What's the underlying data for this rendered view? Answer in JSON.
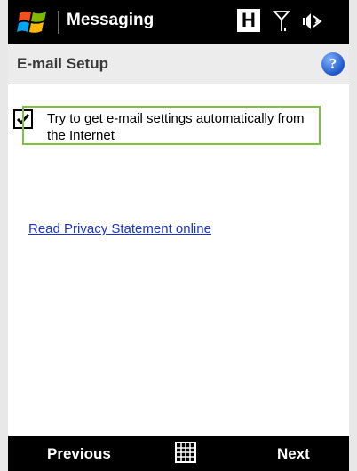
{
  "status_bar": {
    "app_name": "Messaging",
    "h_indicator": "H",
    "icons": [
      "windows-start-icon",
      "h-network-icon",
      "signal-icon",
      "volume-icon"
    ]
  },
  "header": {
    "title": "E-mail Setup",
    "help_glyph": "?",
    "help_icon": "help-icon"
  },
  "main": {
    "auto_settings_option": {
      "label": "Try to get e-mail settings automatically from the Internet",
      "checked": true
    },
    "privacy_link": "Read Privacy Statement online"
  },
  "softkeys": {
    "left_label": "Previous",
    "right_label": "Next",
    "center_icon": "keyboard-icon"
  },
  "colors": {
    "bar_background": "#000000",
    "titlebar_background": "#ececec",
    "focus_border": "#7cc23c",
    "link": "#1a35c9",
    "help_icon": "#1d55c8"
  }
}
